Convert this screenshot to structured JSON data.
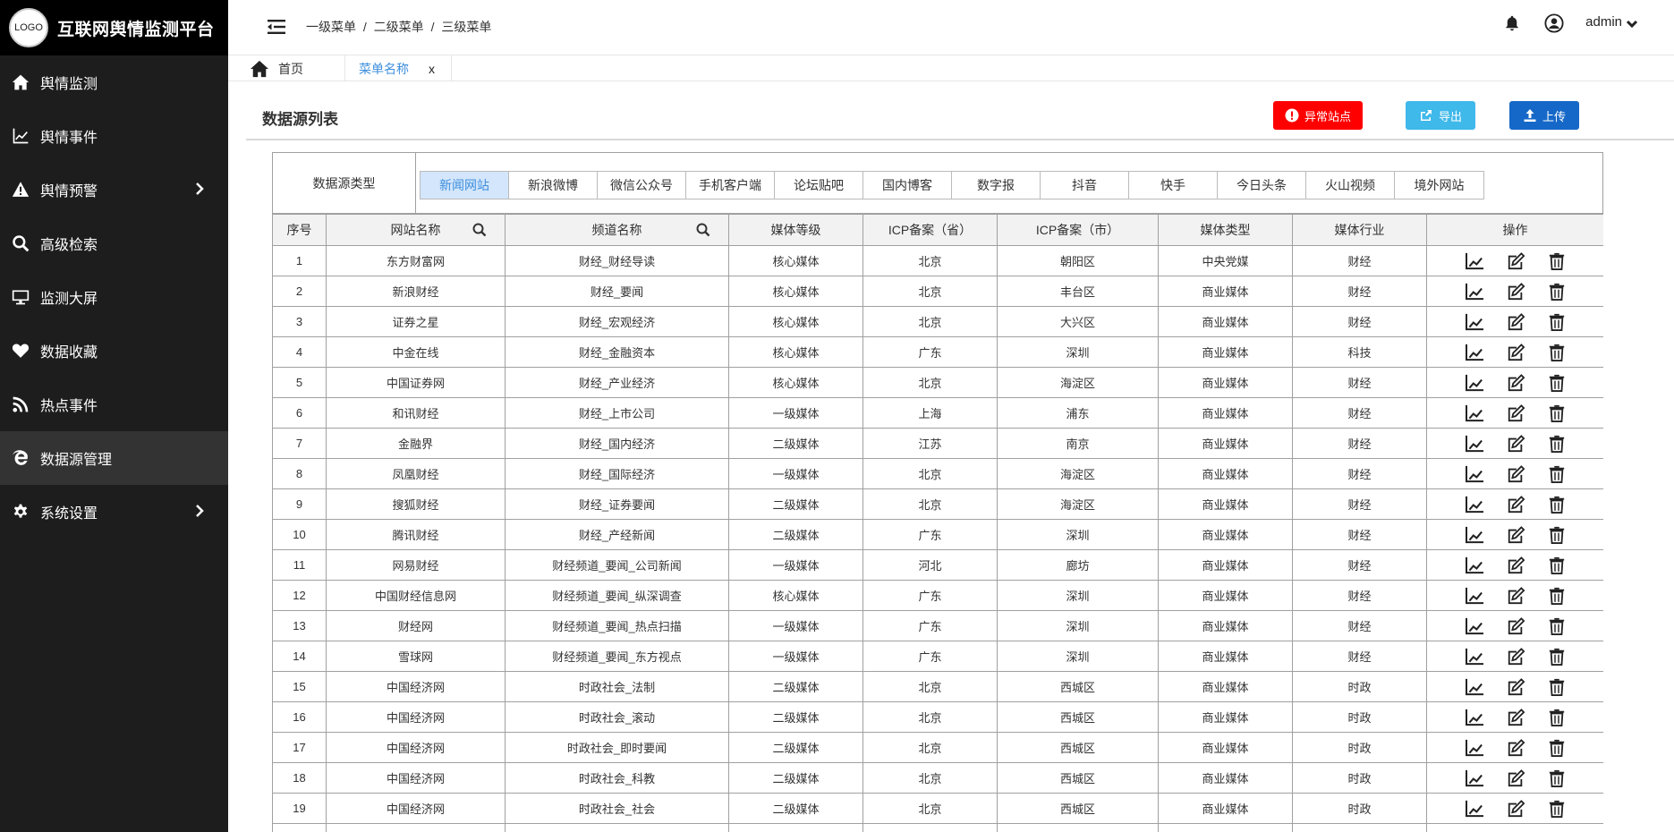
{
  "brand": {
    "logo_text": "LOGO",
    "title": "互联网舆情监测平台"
  },
  "sidebar": {
    "items": [
      {
        "label": "舆情监测",
        "icon": "home-icon",
        "has_arrow": false,
        "active": false
      },
      {
        "label": "舆情事件",
        "icon": "trend-chart-icon",
        "has_arrow": false,
        "active": false
      },
      {
        "label": "舆情预警",
        "icon": "warning-icon",
        "has_arrow": true,
        "active": false
      },
      {
        "label": "高级检索",
        "icon": "search-icon",
        "has_arrow": false,
        "active": false
      },
      {
        "label": "监测大屏",
        "icon": "monitor-icon",
        "has_arrow": false,
        "active": false
      },
      {
        "label": "数据收藏",
        "icon": "heart-icon",
        "has_arrow": false,
        "active": false
      },
      {
        "label": "热点事件",
        "icon": "rss-icon",
        "has_arrow": false,
        "active": false
      },
      {
        "label": "数据源管理",
        "icon": "ie-icon",
        "has_arrow": false,
        "active": true
      },
      {
        "label": "系统设置",
        "icon": "gear-icon",
        "has_arrow": true,
        "active": false
      }
    ]
  },
  "header": {
    "breadcrumb": [
      "一级菜单",
      "二级菜单",
      "三级菜单"
    ],
    "breadcrumb_sep": "/",
    "user": "admin"
  },
  "tabs": {
    "home": "首页",
    "current": "菜单名称",
    "close": "x"
  },
  "page": {
    "title": "数据源列表",
    "buttons": {
      "abnormal": "异常站点",
      "export": "导出",
      "upload": "上传"
    }
  },
  "filter": {
    "label": "数据源类型",
    "options": [
      "新闻网站",
      "新浪微博",
      "微信公众号",
      "手机客户端",
      "论坛贴吧",
      "国内博客",
      "数字报",
      "抖音",
      "快手",
      "今日头条",
      "火山视频",
      "境外网站"
    ],
    "selected": "新闻网站"
  },
  "table": {
    "columns": [
      "序号",
      "网站名称",
      "频道名称",
      "媒体等级",
      "ICP备案（省）",
      "ICP备案（市）",
      "媒体类型",
      "媒体行业",
      "操作"
    ],
    "rows": [
      [
        "1",
        "东方财富网",
        "财经_财经导读",
        "核心媒体",
        "北京",
        "朝阳区",
        "中央党媒",
        "财经"
      ],
      [
        "2",
        "新浪财经",
        "财经_要闻",
        "核心媒体",
        "北京",
        "丰台区",
        "商业媒体",
        "财经"
      ],
      [
        "3",
        "证券之星",
        "财经_宏观经济",
        "核心媒体",
        "北京",
        "大兴区",
        "商业媒体",
        "财经"
      ],
      [
        "4",
        "中金在线",
        "财经_金融资本",
        "核心媒体",
        "广东",
        "深圳",
        "商业媒体",
        "科技"
      ],
      [
        "5",
        "中国证券网",
        "财经_产业经济",
        "核心媒体",
        "北京",
        "海淀区",
        "商业媒体",
        "财经"
      ],
      [
        "6",
        "和讯财经",
        "财经_上市公司",
        "一级媒体",
        "上海",
        "浦东",
        "商业媒体",
        "财经"
      ],
      [
        "7",
        "金融界",
        "财经_国内经济",
        "二级媒体",
        "江苏",
        "南京",
        "商业媒体",
        "财经"
      ],
      [
        "8",
        "凤凰财经",
        "财经_国际经济",
        "一级媒体",
        "北京",
        "海淀区",
        "商业媒体",
        "财经"
      ],
      [
        "9",
        "搜狐财经",
        "财经_证券要闻",
        "二级媒体",
        "北京",
        "海淀区",
        "商业媒体",
        "财经"
      ],
      [
        "10",
        "腾讯财经",
        "财经_产经新闻",
        "二级媒体",
        "广东",
        "深圳",
        "商业媒体",
        "财经"
      ],
      [
        "11",
        "网易财经",
        "财经频道_要闻_公司新闻",
        "一级媒体",
        "河北",
        "廊坊",
        "商业媒体",
        "财经"
      ],
      [
        "12",
        "中国财经信息网",
        "财经频道_要闻_纵深调查",
        "核心媒体",
        "广东",
        "深圳",
        "商业媒体",
        "财经"
      ],
      [
        "13",
        "财经网",
        "财经频道_要闻_热点扫描",
        "一级媒体",
        "广东",
        "深圳",
        "商业媒体",
        "财经"
      ],
      [
        "14",
        "雪球网",
        "财经频道_要闻_东方视点",
        "一级媒体",
        "广东",
        "深圳",
        "商业媒体",
        "财经"
      ],
      [
        "15",
        "中国经济网",
        "时政社会_法制",
        "二级媒体",
        "北京",
        "西城区",
        "商业媒体",
        "时政"
      ],
      [
        "16",
        "中国经济网",
        "时政社会_滚动",
        "二级媒体",
        "北京",
        "西城区",
        "商业媒体",
        "时政"
      ],
      [
        "17",
        "中国经济网",
        "时政社会_即时要闻",
        "二级媒体",
        "北京",
        "西城区",
        "商业媒体",
        "时政"
      ],
      [
        "18",
        "中国经济网",
        "时政社会_科教",
        "二级媒体",
        "北京",
        "西城区",
        "商业媒体",
        "时政"
      ],
      [
        "19",
        "中国经济网",
        "时政社会_社会",
        "二级媒体",
        "北京",
        "西城区",
        "商业媒体",
        "时政"
      ]
    ]
  }
}
